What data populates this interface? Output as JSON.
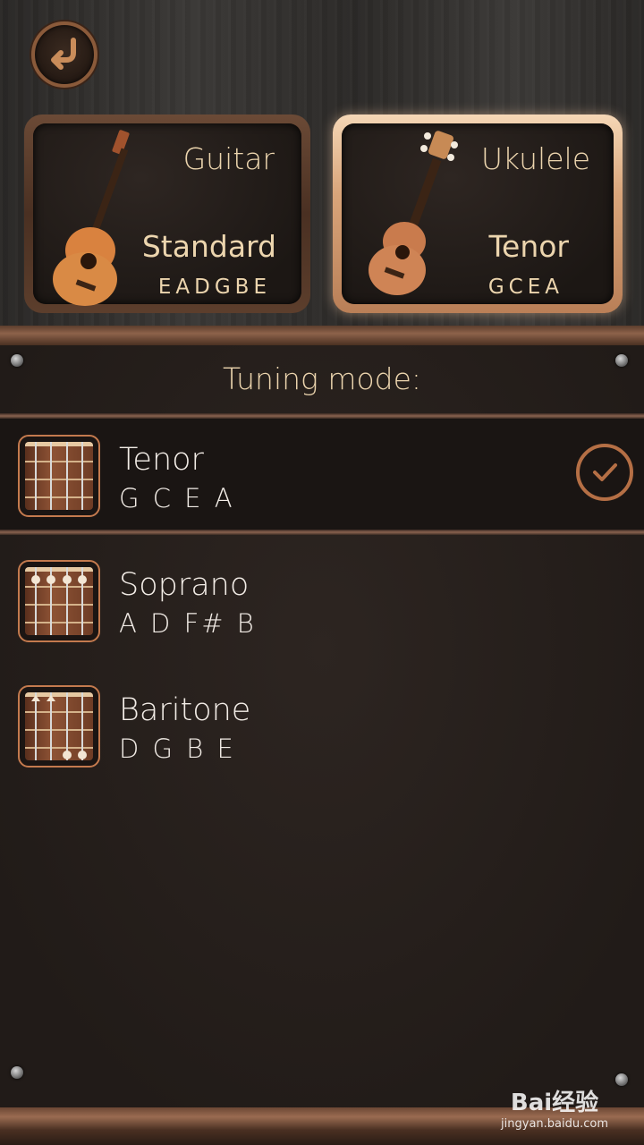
{
  "cards": {
    "guitar": {
      "title": "Guitar",
      "mode": "Standard",
      "notes": "EADGBE"
    },
    "ukulele": {
      "title": "Ukulele",
      "mode": "Tenor",
      "notes": "GCEA"
    }
  },
  "panel": {
    "header": "Tuning mode:"
  },
  "modes": [
    {
      "name": "Tenor",
      "notes": "G C E A",
      "selected": true
    },
    {
      "name": "Soprano",
      "notes": "A D F# B",
      "selected": false
    },
    {
      "name": "Baritone",
      "notes": "D G B E",
      "selected": false
    }
  ],
  "watermark": {
    "logo": "Bai经验",
    "url": "jingyan.baidu.com"
  },
  "colors": {
    "accent": "#b56f45",
    "text_light": "#ecd5ae",
    "row_text": "#f2ece6"
  }
}
